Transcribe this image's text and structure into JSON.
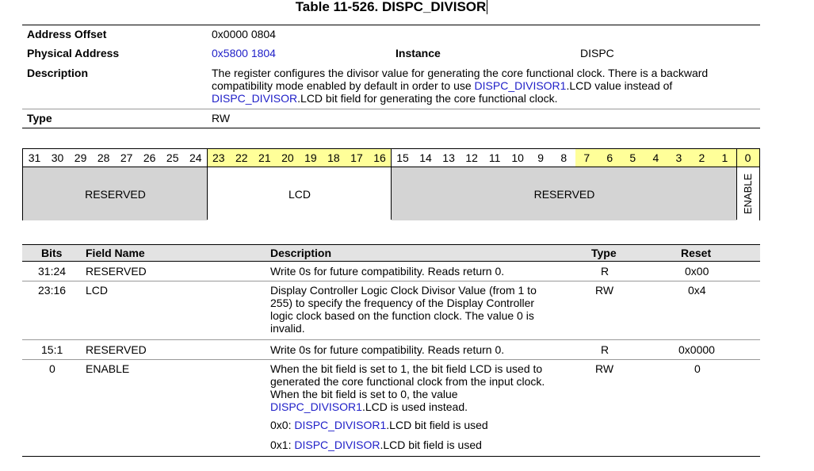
{
  "title": "Table 11-526. DISPC_DIVISOR",
  "header": {
    "address_offset_label": "Address Offset",
    "address_offset_value": "0x0000 0804",
    "physical_address_label": "Physical Address",
    "physical_address_value": "0x5800 1804",
    "instance_label": "Instance",
    "instance_value": "DISPC",
    "description_label": "Description",
    "description_line1": "The register configures the divisor value for generating the core functional clock. There is a backward",
    "description_line2_pre": "compatibility mode enabled by default in order to use ",
    "description_line2_link": "DISPC_DIVISOR1",
    "description_line2_post": ".LCD value instead of",
    "description_line3_link": "DISPC_DIVISOR",
    "description_line3_post": ".LCD bit field for generating the core functional clock.",
    "type_label": "Type",
    "type_value": "RW"
  },
  "bit_numbers": [
    "31",
    "30",
    "29",
    "28",
    "27",
    "26",
    "25",
    "24",
    "23",
    "22",
    "21",
    "20",
    "19",
    "18",
    "17",
    "16",
    "15",
    "14",
    "13",
    "12",
    "11",
    "10",
    "9",
    "8",
    "7",
    "6",
    "5",
    "4",
    "3",
    "2",
    "1",
    "0"
  ],
  "bit_fields": {
    "reserved_high": "RESERVED",
    "lcd": "LCD",
    "reserved_low": "RESERVED",
    "enable": "ENABLE"
  },
  "table": {
    "headers": {
      "bits": "Bits",
      "field_name": "Field Name",
      "description": "Description",
      "type": "Type",
      "reset": "Reset"
    },
    "rows": [
      {
        "bits": "31:24",
        "field": "RESERVED",
        "desc": [
          "Write 0s for future compatibility. Reads return 0."
        ],
        "type": "R",
        "reset": "0x00"
      },
      {
        "bits": "23:16",
        "field": "LCD",
        "desc": [
          "Display Controller Logic Clock Divisor Value (from 1 to",
          "255) to specify the frequency of the Display Controller",
          "logic clock based on the function clock. The value 0 is",
          "invalid."
        ],
        "type": "RW",
        "reset": "0x4"
      },
      {
        "bits": "15:1",
        "field": "RESERVED",
        "desc": [
          "Write 0s for future compatibility. Reads return 0."
        ],
        "type": "R",
        "reset": "0x0000"
      },
      {
        "bits": "0",
        "field": "ENABLE",
        "desc": [
          "When the bit field is set to 1, the bit field LCD is used to",
          "generated the core functional clock from the input clock.",
          "When the bit field is set to 0, the value"
        ],
        "desc_link_line_link": "DISPC_DIVISOR1",
        "desc_link_line_post": ".LCD is used instead.",
        "opt0_pre": "0x0: ",
        "opt0_link": "DISPC_DIVISOR1",
        "opt0_post": ".LCD bit field is used",
        "opt1_pre": "0x1: ",
        "opt1_link": "DISPC_DIVISOR",
        "opt1_post": ".LCD bit field is used",
        "type": "RW",
        "reset": "0"
      }
    ]
  }
}
